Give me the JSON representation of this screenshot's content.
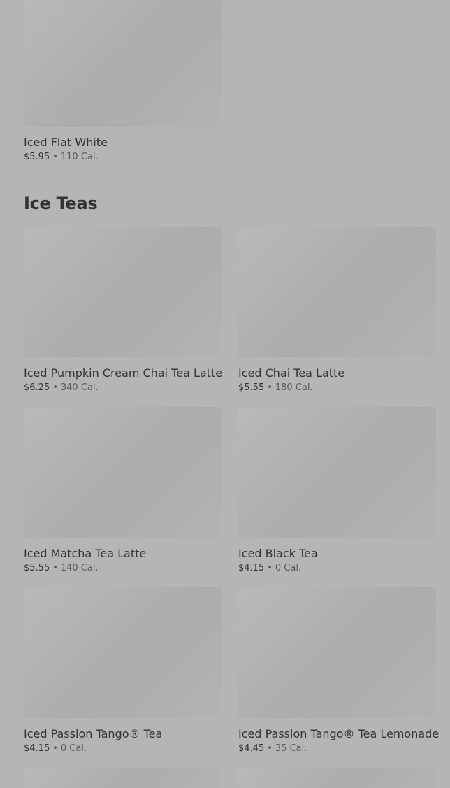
{
  "top_item": {
    "name": "Iced Flat White",
    "price": "$5.95",
    "separator": "•",
    "calories": "110 Cal."
  },
  "section": {
    "title": "Ice Teas"
  },
  "items": [
    {
      "name": "Iced Pumpkin Cream Chai Tea Latte",
      "price": "$6.25",
      "separator": "•",
      "calories": "340 Cal."
    },
    {
      "name": "Iced Chai Tea Latte",
      "price": "$5.55",
      "separator": "•",
      "calories": "180 Cal."
    },
    {
      "name": "Iced Matcha Tea Latte",
      "price": "$5.55",
      "separator": "•",
      "calories": "140 Cal."
    },
    {
      "name": "Iced Black Tea",
      "price": "$4.15",
      "separator": "•",
      "calories": "0 Cal."
    },
    {
      "name": "Iced Passion Tango® Tea",
      "price": "$4.15",
      "separator": "•",
      "calories": "0 Cal."
    },
    {
      "name": "Iced Passion Tango® Tea Lemonade",
      "price": "$4.45",
      "separator": "•",
      "calories": "35 Cal."
    }
  ]
}
